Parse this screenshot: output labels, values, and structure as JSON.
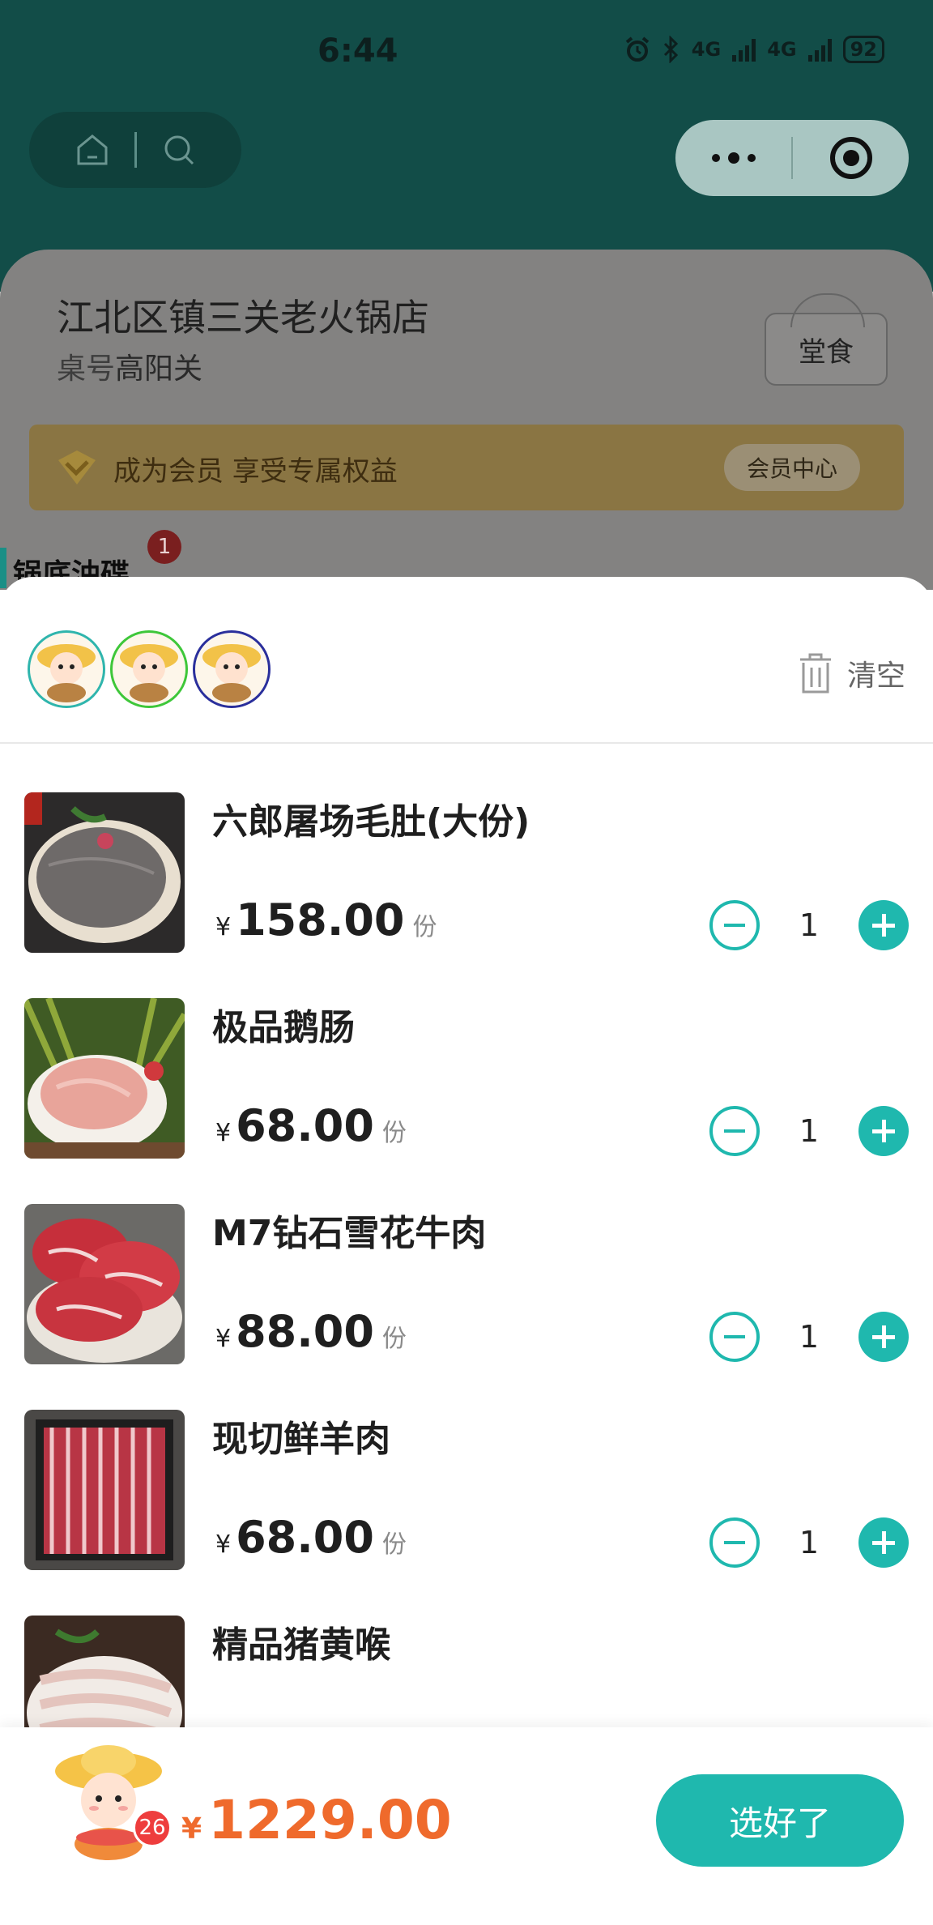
{
  "status_bar": {
    "time": "6:44",
    "net1": "4G",
    "net2": "4G",
    "battery": "92"
  },
  "store": {
    "name": "江北区镇三关老火锅店",
    "table_label": "桌号",
    "table_value": "高阳关",
    "dine_type": "堂食"
  },
  "member": {
    "banner_text": "成为会员 享受专属权益",
    "center_label": "会员中心"
  },
  "category_peek": {
    "label": "锅底油碟",
    "badge": "1"
  },
  "cart": {
    "clear_label": "清空",
    "items": [
      {
        "name": "六郎屠场毛肚(大份)",
        "currency": "¥",
        "price": "158.00",
        "unit": "份",
        "qty": "1"
      },
      {
        "name": "极品鹅肠",
        "currency": "¥",
        "price": "68.00",
        "unit": "份",
        "qty": "1"
      },
      {
        "name": "M7钻石雪花牛肉",
        "currency": "¥",
        "price": "88.00",
        "unit": "份",
        "qty": "1"
      },
      {
        "name": "现切鲜羊肉",
        "currency": "¥",
        "price": "68.00",
        "unit": "份",
        "qty": "1"
      },
      {
        "name": "精品猪黄喉",
        "currency": "¥",
        "price": "",
        "unit": "",
        "qty": ""
      }
    ]
  },
  "bottom": {
    "badge_count": "26",
    "currency": "¥",
    "total": "1229.00",
    "confirm_label": "选好了"
  },
  "colors": {
    "accent": "#1fb8ae",
    "total_price": "#ef6a2c",
    "badge": "#ee3d3d"
  }
}
